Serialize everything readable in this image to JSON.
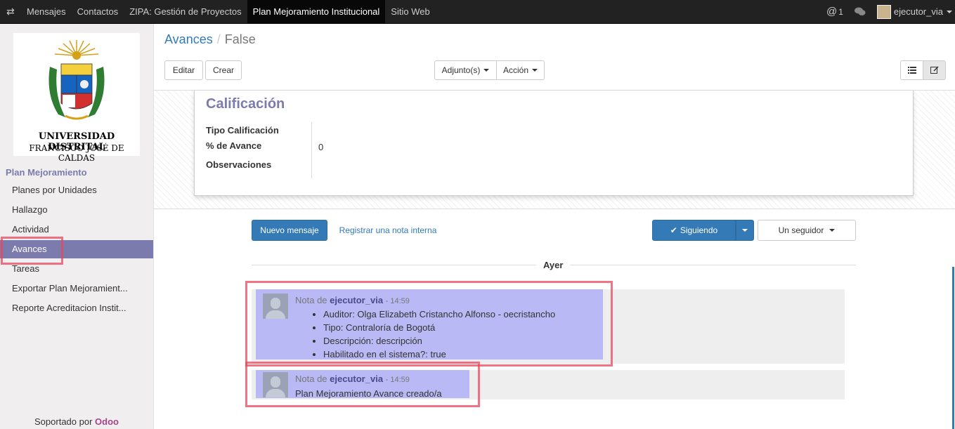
{
  "topbar": {
    "menu": [
      {
        "label": "Mensajes",
        "active": false
      },
      {
        "label": "Contactos",
        "active": false
      },
      {
        "label": "ZIPA: Gestión de Proyectos",
        "active": false
      },
      {
        "label": "Plan Mejoramiento Institucional",
        "active": true
      },
      {
        "label": "Sitio Web",
        "active": false
      }
    ],
    "notifications": "1",
    "user": "ejecutor_via"
  },
  "sidebar": {
    "logo": {
      "line1": "UNIVERSIDAD DISTRITAL",
      "line2": "FRANCISCO JOSÉ DE CALDAS"
    },
    "section": "Plan Mejoramiento",
    "items": [
      {
        "label": "Planes por Unidades",
        "active": false
      },
      {
        "label": "Hallazgo",
        "active": false
      },
      {
        "label": "Actividad",
        "active": false
      },
      {
        "label": "Avances",
        "active": true
      },
      {
        "label": "Tareas",
        "active": false
      },
      {
        "label": "Exportar Plan Mejoramient...",
        "active": false
      },
      {
        "label": "Reporte Acreditacion Instit...",
        "active": false
      }
    ],
    "footer": {
      "prefix": "Soportado por",
      "brand": "Odoo"
    }
  },
  "breadcrumb": {
    "parent": "Avances",
    "current": "False"
  },
  "toolbar": {
    "edit": "Editar",
    "create": "Crear",
    "attachments": "Adjunto(s)",
    "action": "Acción"
  },
  "form": {
    "section_title": "Calificación",
    "fields": [
      {
        "label": "Tipo Calificación",
        "value": ""
      },
      {
        "label": "% de Avance",
        "value": "0"
      },
      {
        "label": "Observaciones",
        "value": ""
      }
    ]
  },
  "chatter": {
    "new_message": "Nuevo mensaje",
    "log_note": "Registrar una nota interna",
    "following": "Siguiendo",
    "followers": "Un seguidor",
    "day": "Ayer",
    "messages": [
      {
        "prefix": "Nota de",
        "author": "ejecutor_via",
        "time": "- 14:59",
        "items": [
          "Auditor: Olga Elizabeth Cristancho Alfonso - oecristancho",
          "Tipo: Contraloría de Bogotá",
          "Descripción: descripción",
          "Habilitado en el sistema?: true"
        ]
      },
      {
        "prefix": "Nota de",
        "author": "ejecutor_via",
        "time": "- 14:59",
        "text": "Plan Mejoramiento Avance creado/a"
      }
    ]
  },
  "colors": {
    "brand": "#7c7bad",
    "link": "#337ab7",
    "primary": "#337ab7",
    "highlight": "#eb465a"
  }
}
